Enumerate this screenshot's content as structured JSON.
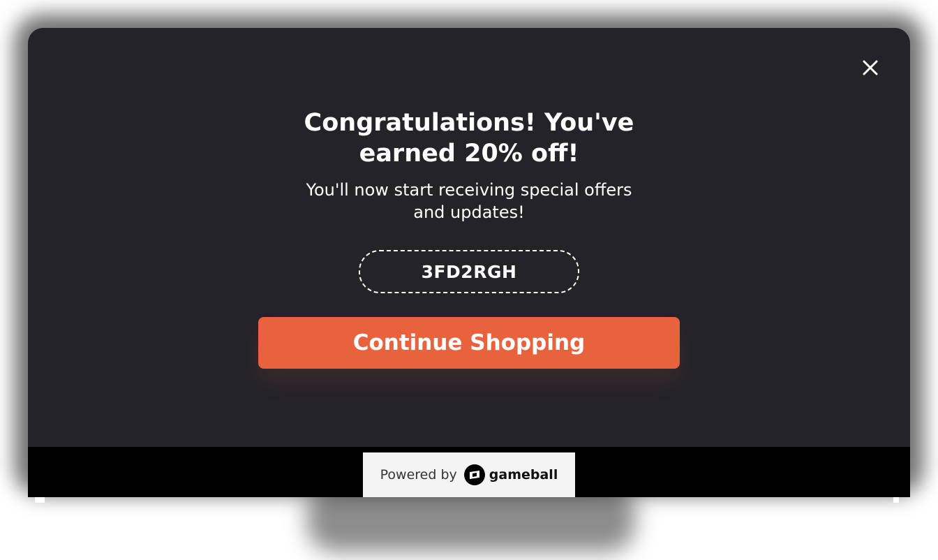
{
  "modal": {
    "title": "Congratulations! You've earned 20% off!",
    "subtitle": "You'll now start receiving special offers and updates!",
    "coupon_code": "3FD2RGH",
    "cta_label": "Continue Shopping",
    "close_icon": "close-icon"
  },
  "footer": {
    "powered_by_label": "Powered by",
    "brand_name": "gameball",
    "brand_icon": "gameball-logo-icon"
  },
  "colors": {
    "modal_background": "#232328",
    "accent": "#e8623e",
    "text": "#ffffff",
    "footer_badge": "#f4f4f4"
  }
}
